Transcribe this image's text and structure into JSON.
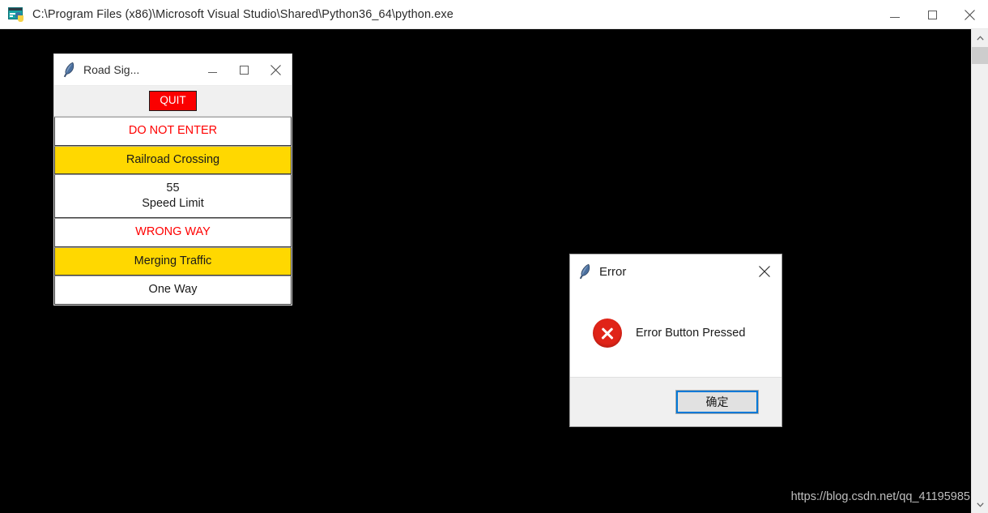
{
  "console": {
    "title": "C:\\Program Files (x86)\\Microsoft Visual Studio\\Shared\\Python36_64\\python.exe",
    "app_icon": "python-console-icon",
    "background_color": "#000000",
    "caption": {
      "minimize_label": "Minimize",
      "maximize_label": "Maximize",
      "close_label": "Close"
    }
  },
  "tk_window": {
    "title": "Road Sig...",
    "icon": "tkinter-feather-icon",
    "caption": {
      "minimize_label": "Minimize",
      "maximize_label": "Maximize",
      "close_label": "Close"
    },
    "quit_button": {
      "label": "QUIT",
      "background_color": "#FB0000",
      "text_color": "#FFFFFF"
    },
    "buttons": [
      {
        "label": "DO NOT ENTER",
        "background_color": "#FFFFFF",
        "text_color": "#FF0000"
      },
      {
        "label": "Railroad Crossing",
        "background_color": "#FFD800",
        "text_color": "#1A1A1A"
      },
      {
        "label": "55",
        "label2": "Speed Limit",
        "background_color": "#FFFFFF",
        "text_color": "#1A1A1A"
      },
      {
        "label": "WRONG WAY",
        "background_color": "#FFFFFF",
        "text_color": "#FF0000"
      },
      {
        "label": "Merging Traffic",
        "background_color": "#FFD800",
        "text_color": "#1A1A1A"
      },
      {
        "label": "One Way",
        "background_color": "#FFFFFF",
        "text_color": "#1A1A1A"
      }
    ]
  },
  "error_dialog": {
    "title": "Error",
    "icon": "tkinter-feather-icon",
    "close_label": "Close",
    "error_icon": "error-circle-icon",
    "error_icon_color": "#E02418",
    "message": "Error Button Pressed",
    "ok_button": {
      "label": "确定",
      "focus_color": "#0078D7"
    }
  },
  "scrollbar": {
    "up_arrow": "chevron-up-icon",
    "down_arrow": "chevron-down-icon",
    "thumb_color": "#CDCDCD"
  },
  "watermark": {
    "text": "https://blog.csdn.net/qq_41195985"
  }
}
